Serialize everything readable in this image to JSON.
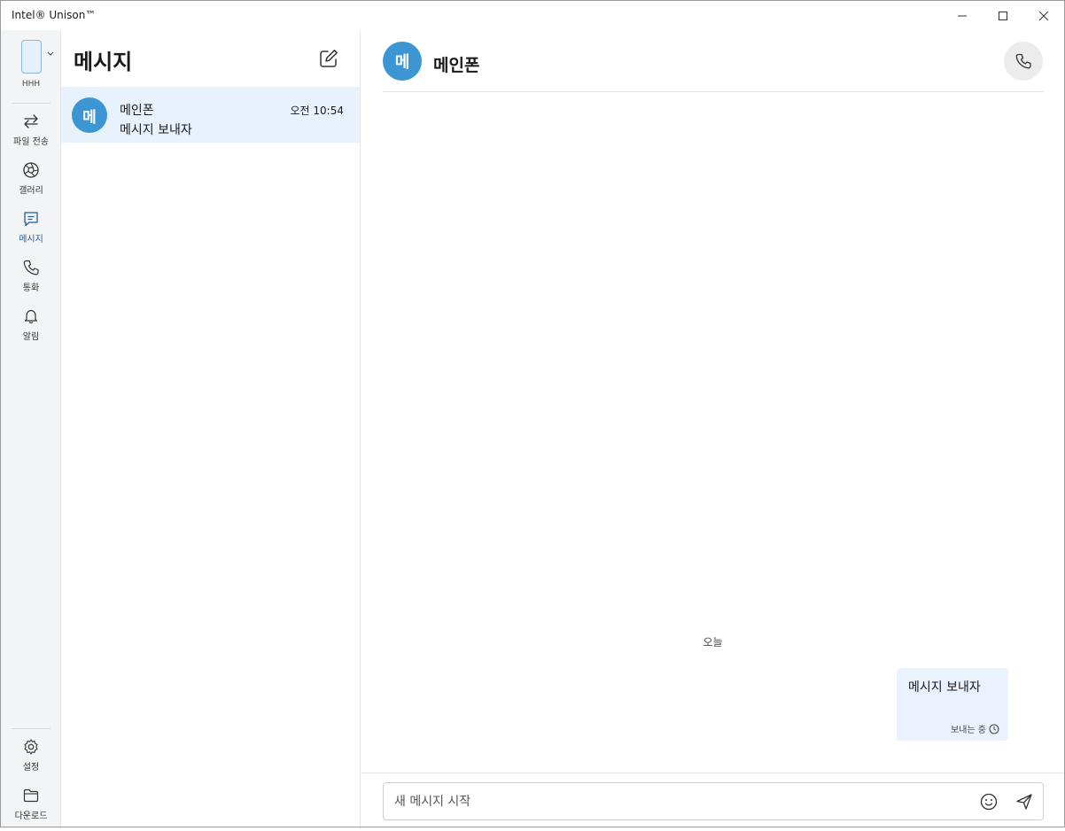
{
  "window": {
    "title": "Intel® Unison™",
    "controls": {
      "minimize": "minimize-icon",
      "maximize": "maximize-icon",
      "close": "close-icon"
    }
  },
  "nav": {
    "device_name": "HHH",
    "items": [
      {
        "label": "파일 전송",
        "icon": "transfer-arrows-icon"
      },
      {
        "label": "갤러리",
        "icon": "aperture-icon"
      },
      {
        "label": "메시지",
        "icon": "message-icon",
        "active": true
      },
      {
        "label": "통화",
        "icon": "phone-icon"
      },
      {
        "label": "알림",
        "icon": "bell-icon"
      }
    ],
    "bottom_items": [
      {
        "label": "설정",
        "icon": "gear-icon"
      },
      {
        "label": "다운로드",
        "icon": "folder-icon"
      }
    ]
  },
  "list": {
    "title": "메시지",
    "conversations": [
      {
        "avatar": "메",
        "name": "메인폰",
        "time": "오전 10:54",
        "preview": "메시지 보내자"
      }
    ]
  },
  "chat": {
    "avatar": "메",
    "name": "메인폰",
    "date_separator": "오늘",
    "messages": [
      {
        "text": "메시지 보내자",
        "status": "보내는 중"
      }
    ],
    "composer": {
      "placeholder": "새 메시지 시작"
    }
  },
  "colors": {
    "accent": "#3d96d4",
    "selected_row": "#e8f2fd",
    "bubble": "#eaf2fd",
    "nav_bg": "#f3f4f6"
  }
}
